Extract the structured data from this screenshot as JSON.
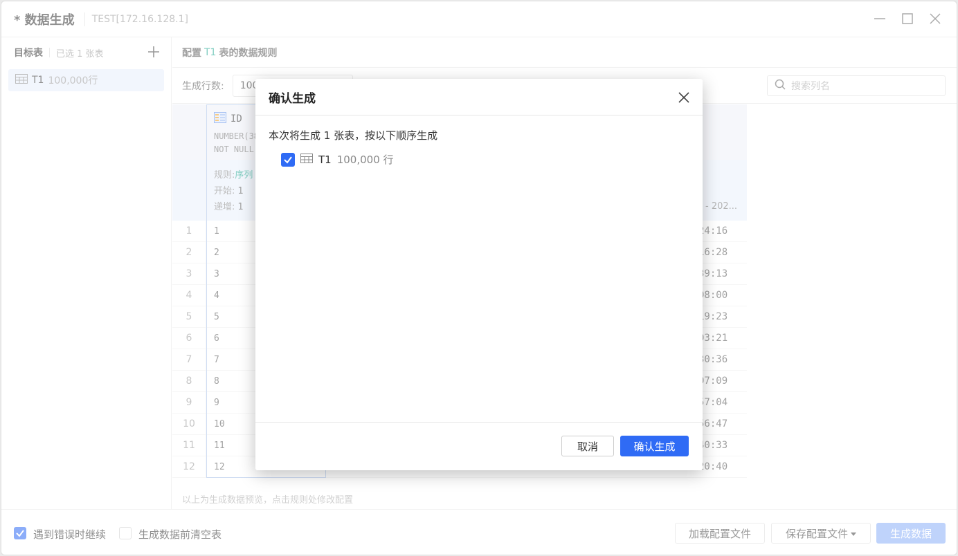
{
  "window": {
    "title": "* 数据生成",
    "connection": "TEST[172.16.128.1]"
  },
  "sidebar": {
    "header": "目标表",
    "selected_count": "已选 1 张表",
    "items": [
      {
        "name": "T1",
        "rows": "100,000行"
      }
    ]
  },
  "main": {
    "header_prefix": "配置",
    "header_table": "T1",
    "header_suffix": "表的数据规则",
    "row_count_label": "生成行数:",
    "row_count_value": "100",
    "search_placeholder": "搜索列名",
    "column": {
      "name": "ID",
      "type_line1": "NUMBER(38",
      "type_line2": "NOT NULL",
      "rule_label": "规则:",
      "rule_value": "序列",
      "start_label": "开始:",
      "start_value": "1",
      "step_label": "递增:",
      "step_value": "1"
    },
    "date_col_header": "- 202...",
    "rows": [
      {
        "n": "1",
        "id": "1",
        "t": "24:16"
      },
      {
        "n": "2",
        "id": "2",
        "t": "16:28"
      },
      {
        "n": "3",
        "id": "3",
        "t": "39:13"
      },
      {
        "n": "4",
        "id": "4",
        "t": "08:00"
      },
      {
        "n": "5",
        "id": "5",
        "t": "19:23"
      },
      {
        "n": "6",
        "id": "6",
        "t": "03:21"
      },
      {
        "n": "7",
        "id": "7",
        "t": "30:36"
      },
      {
        "n": "8",
        "id": "8",
        "t": "07:09"
      },
      {
        "n": "9",
        "id": "9",
        "t": "57:04"
      },
      {
        "n": "10",
        "id": "10",
        "t": "56:47"
      },
      {
        "n": "11",
        "id": "11",
        "t": "40:33"
      },
      {
        "n": "12",
        "id": "12",
        "t": "20:40"
      }
    ],
    "preview_note": "以上为生成数据预览，点击规则处修改配置"
  },
  "bottom": {
    "continue_on_error": "遇到错误时继续",
    "clear_before": "生成数据前清空表",
    "load_config": "加载配置文件",
    "save_config": "保存配置文件",
    "generate": "生成数据"
  },
  "dialog": {
    "title": "确认生成",
    "description": "本次将生成 1 张表，按以下顺序生成",
    "item_name": "T1",
    "item_rows": "100,000 行",
    "cancel": "取消",
    "confirm": "确认生成"
  },
  "colors": {
    "accent": "#2f6bf5",
    "table_name": "#1aa58f"
  }
}
